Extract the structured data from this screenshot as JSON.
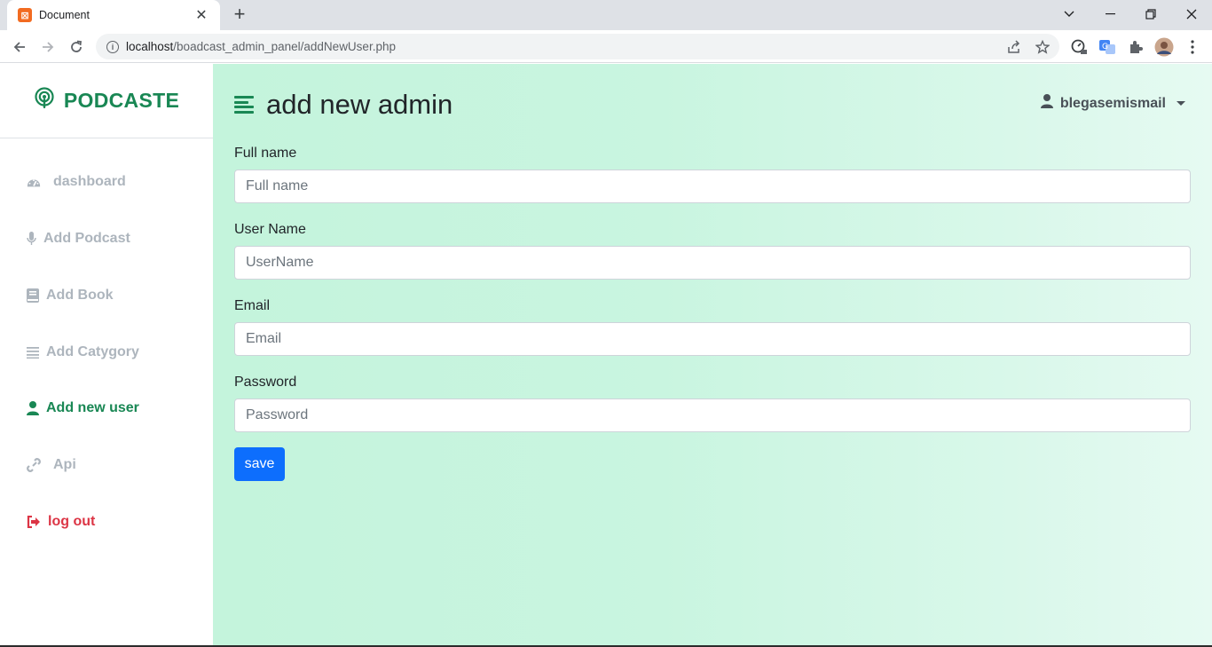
{
  "browser": {
    "tab_title": "Document",
    "tab_favicon": "xampp-icon",
    "url_host": "localhost",
    "url_path": "/boadcast_admin_panel/addNewUser.php"
  },
  "sidebar": {
    "brand": "PODCASTE",
    "items": [
      {
        "label": "dashboard",
        "icon": "gauge-icon"
      },
      {
        "label": "Add Podcast",
        "icon": "microphone-icon"
      },
      {
        "label": "Add Book",
        "icon": "book-icon"
      },
      {
        "label": "Add Catygory",
        "icon": "list-icon"
      },
      {
        "label": "Add new user",
        "icon": "user-icon",
        "active": true
      },
      {
        "label": "Api",
        "icon": "link-icon"
      },
      {
        "label": "log out",
        "icon": "sign-out-icon"
      }
    ]
  },
  "header": {
    "title": "add new admin",
    "username": "blegasemismail"
  },
  "form": {
    "fullname": {
      "label": "Full name",
      "placeholder": "Full name"
    },
    "username": {
      "label": "User Name",
      "placeholder": "UserName"
    },
    "email": {
      "label": "Email",
      "placeholder": "Email"
    },
    "password": {
      "label": "Password",
      "placeholder": "Password"
    },
    "save_label": "save"
  },
  "colors": {
    "brand": "#198754",
    "danger": "#dc3545",
    "primary_button": "#0d6efd",
    "muted_nav": "#adb5bd"
  }
}
